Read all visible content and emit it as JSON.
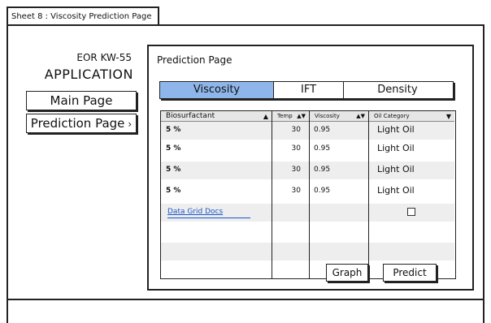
{
  "sheet": {
    "title": "Sheet 8 : Viscosity Prediction Page"
  },
  "app": {
    "code": "EOR KW-55",
    "name": "APPLICATION"
  },
  "nav": {
    "main_label": "Main Page",
    "prediction_label": "Prediction Page",
    "prediction_chevron": "›"
  },
  "panel": {
    "title": "Prediction Page"
  },
  "tabs": [
    {
      "label": "Viscosity",
      "active": true
    },
    {
      "label": "IFT",
      "active": false
    },
    {
      "label": "Density",
      "active": false
    }
  ],
  "grid": {
    "columns": [
      {
        "label": "Biosurfactant",
        "sort_icon": "▲"
      },
      {
        "label": "Temp",
        "sort_icon": "▲▼"
      },
      {
        "label": "Viscosity",
        "sort_icon": "▲▼"
      },
      {
        "label": "Oil Category",
        "sort_icon": "▼"
      }
    ],
    "rows": [
      {
        "biosurfactant": "5 %",
        "temp": "30",
        "viscosity": "0.95",
        "oil_category": "Light Oil"
      },
      {
        "biosurfactant": "5 %",
        "temp": "30",
        "viscosity": "0.95",
        "oil_category": "Light Oil"
      },
      {
        "biosurfactant": "5 %",
        "temp": "30",
        "viscosity": "0.95",
        "oil_category": "Light Oil"
      },
      {
        "biosurfactant": "5 %",
        "temp": "30",
        "viscosity": "0.95",
        "oil_category": "Light Oil"
      }
    ],
    "link_text": "Data Grid Docs",
    "checkbox_checked": false
  },
  "buttons": {
    "graph": "Graph",
    "predict": "Predict"
  },
  "colors": {
    "active_tab": "#8fb6ea",
    "link": "#1a56c8",
    "row_alt": "#eeeeee"
  }
}
